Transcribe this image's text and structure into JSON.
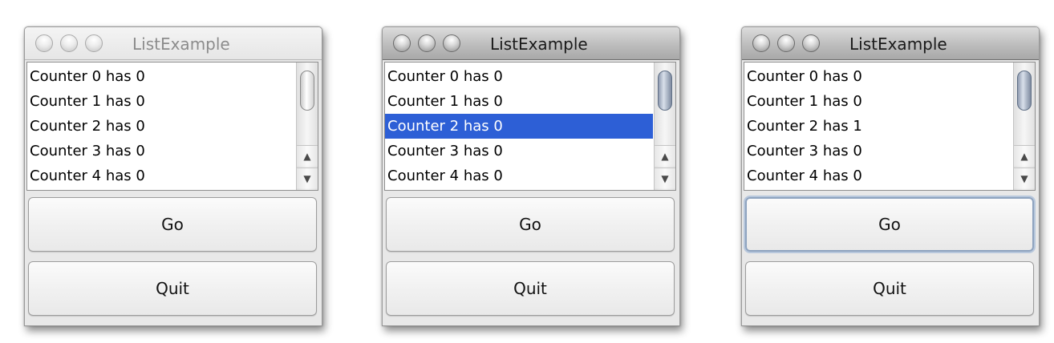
{
  "windows": [
    {
      "title": "ListExample",
      "rows": [
        "Counter 0 has 0",
        "Counter 1 has 0",
        "Counter 2 has 0",
        "Counter 3 has 0",
        "Counter 4 has 0"
      ],
      "go_label": "Go",
      "quit_label": "Quit"
    },
    {
      "title": "ListExample",
      "rows": [
        "Counter 0 has 0",
        "Counter 1 has 0",
        "Counter 2 has 0",
        "Counter 3 has 0",
        "Counter 4 has 0"
      ],
      "go_label": "Go",
      "quit_label": "Quit"
    },
    {
      "title": "ListExample",
      "rows": [
        "Counter 0 has 0",
        "Counter 1 has 0",
        "Counter 2 has 1",
        "Counter 3 has 0",
        "Counter 4 has 0"
      ],
      "go_label": "Go",
      "quit_label": "Quit"
    }
  ],
  "icons": {
    "scroll_up": "▲",
    "scroll_down": "▼"
  },
  "colors": {
    "selection": "#2d5fd6",
    "focus_ring": "#8ea3bf"
  }
}
